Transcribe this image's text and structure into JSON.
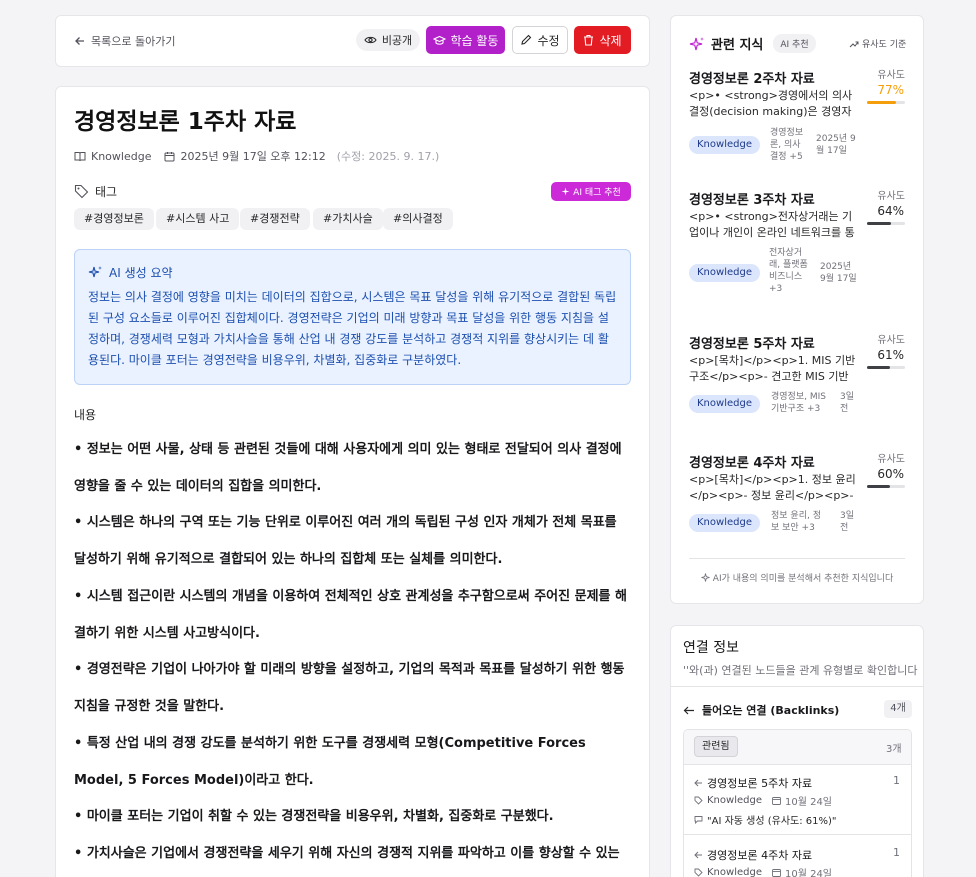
{
  "toolbar": {
    "back": "목록으로 돌아가기",
    "private": "비공개",
    "study": "학습 활동",
    "edit": "수정",
    "delete": "삭제"
  },
  "doc": {
    "title": "경영정보론 1주차 자료",
    "type": "Knowledge",
    "date": "2025년 9월 17일 오후 12:12",
    "modified": "(수정: 2025. 9. 17.)",
    "tags_label": "태그",
    "ai_tag_button": "AI 태그 추천",
    "tags": [
      "#경영정보론",
      "#시스템 사고",
      "#경쟁전략",
      "#가치사슬",
      "#의사결정"
    ],
    "ai_summary_title": "AI 생성 요약",
    "ai_summary": "정보는 의사 결정에 영향을 미치는 데이터의 집합으로, 시스템은 목표 달성을 위해 유기적으로 결합된 독립된 구성 요소들로 이루어진 집합체이다. 경영전략은 기업의 미래 방향과 목표 달성을 위한 행동 지침을 설정하며, 경쟁세력 모형과 가치사슬을 통해 산업 내 경쟁 강도를 분석하고 경쟁적 지위를 향상시키는 데 활용된다. 마이클 포터는 경영전략을 비용우위, 차별화, 집중화로 구분하였다.",
    "content_label": "내용",
    "paragraphs": [
      "• 정보는 어떤 사물, 상태 등 관련된 것들에 대해 사용자에게 의미 있는 형태로 전달되어 의사 결정에 영향을 줄 수 있는 데이터의 집합을 의미한다.",
      "• 시스템은 하나의 구역 또는 기능 단위로 이루어진 여러 개의 독립된 구성 인자 개체가 전체 목표를 달성하기 위해 유기적으로 결합되어 있는 하나의 집합체 또는 실체를 의미한다.",
      "• 시스템 접근이란 시스템의 개념을 이용하여 전체적인 상호 관계성을 추구함으로써 주어진 문제를 해결하기 위한 시스템 사고방식이다.",
      "• 경영전략은 기업이 나아가야 할 미래의 방향을 설정하고, 기업의 목적과 목표를 달성하기 위한 행동 지침을 규정한 것을 말한다.",
      "• 특정 산업 내의 경쟁 강도를 분석하기 위한 도구를 경쟁세력 모형(Competitive Forces Model, 5 Forces Model)이라고 한다.",
      "• 마이클 포터는 기업이 취할 수 있는 경쟁전략을 비용우위, 차별화, 집중화로 구분했다.",
      "• 가치사슬은 기업에서 경쟁전략을 세우기 위해 자신의 경쟁적 지위를 파악하고 이를 향상할 수 있는 지점을 찾"
    ]
  },
  "related": {
    "title": "관련 지식",
    "ai_badge": "AI 추천",
    "sort": "유사도 기준",
    "similarity_label": "유사도",
    "items": [
      {
        "title": "경영정보론 2주차 자료",
        "snippet": "<p>• <strong>경영에서의 의사결정(decision making)은 경영자가...",
        "badge": "Knowledge",
        "tags": "경영정보론, 의사결정 +5",
        "date": "2025년 9월 17일",
        "pct": "77%",
        "value": 0.77,
        "color": "#f59e0b"
      },
      {
        "title": "경영정보론 3주차 자료",
        "snippet": "<p>• <strong>전자상거래는 기업이나 개인이 온라인 네트워크를 통해...",
        "badge": "Knowledge",
        "tags": "전자상거래, 플랫폼 비즈니스 +3",
        "date": "2025년 9월 17일",
        "pct": "64%",
        "value": 0.64,
        "color": "#3f3f46"
      },
      {
        "title": "경영정보론 5주차 자료",
        "snippet": "<p>[목차]</p><p>1. MIS 기반구조</p><p>- 견고한 MIS 기반구...",
        "badge": "Knowledge",
        "tags": "경영정보, MIS 기반구조 +3",
        "date": "3일 전",
        "pct": "61%",
        "value": 0.61,
        "color": "#3f3f46"
      },
      {
        "title": "경영정보론 4주차 자료",
        "snippet": "<p>[목차]</p><p>1. 정보 윤리</p><p>- 정보 윤리</p><p>- ...",
        "badge": "Knowledge",
        "tags": "정보 윤리, 정보 보안 +3",
        "date": "3일 전",
        "pct": "60%",
        "value": 0.6,
        "color": "#3f3f46"
      }
    ],
    "footer": "AI가 내용의 의미를 분석해서 추천한 지식입니다"
  },
  "connections": {
    "title": "연결 정보",
    "subtitle": "''와(과) 연결된 노드들을 관계 유형별로 확인합니다",
    "backlinks_title": "들어오는 연결 (Backlinks)",
    "backlinks_count": "4개",
    "group_label": "관련됨",
    "group_count": "3개",
    "items": [
      {
        "title": "경영정보론 5주차 자료",
        "type": "Knowledge",
        "date": "10월 24일",
        "note": "\"AI 자동 생성 (유사도: 61%)\"",
        "num": "1"
      },
      {
        "title": "경영정보론 4주차 자료",
        "type": "Knowledge",
        "date": "10월 24일",
        "num": "1"
      }
    ]
  },
  "colors": {
    "study": "#b220c9",
    "delete": "#e31b23",
    "ai_tag": "#cc2ad8",
    "summary_bg": "#e9f2fe",
    "summary_text": "#1d4fb0",
    "accent_77": "#f59e0b"
  }
}
